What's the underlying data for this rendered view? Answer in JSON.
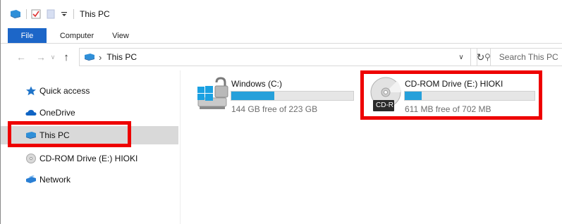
{
  "window": {
    "title": "This PC"
  },
  "ribbon": {
    "tabs": [
      "File",
      "Computer",
      "View"
    ]
  },
  "address": {
    "location": "This PC",
    "search_placeholder": "Search This PC"
  },
  "nav_pane": {
    "items": [
      {
        "label": "Quick access",
        "icon": "star-icon"
      },
      {
        "label": "OneDrive",
        "icon": "cloud-icon"
      },
      {
        "label": "This PC",
        "icon": "computer-icon",
        "selected": true
      },
      {
        "label": "CD-ROM Drive (E:) HIOKI",
        "icon": "disc-icon"
      },
      {
        "label": "Network",
        "icon": "network-icon"
      }
    ]
  },
  "drives": [
    {
      "name": "Windows (C:)",
      "free_text": "144 GB free of 223 GB",
      "used_fraction": 0.354
    },
    {
      "name": "CD-ROM Drive (E:) HIOKI",
      "free_text": "611 MB free of 702 MB",
      "used_fraction": 0.13,
      "badge": "CD-R"
    }
  ],
  "colors": {
    "accent": "#1c66c8",
    "bar_fill": "#26a0da",
    "highlight": "#ee0000",
    "selection": "#d9d9d9"
  }
}
